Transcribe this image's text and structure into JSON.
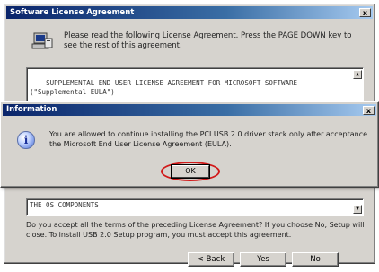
{
  "license_window": {
    "title": "Software License Agreement",
    "close_glyph": "x",
    "prompt": "Please read the following License Agreement. Press the PAGE DOWN key to see the rest of this agreement.",
    "license_text_top": "SUPPLEMENTAL END USER LICENSE AGREEMENT FOR MICROSOFT SOFTWARE (\"Supplemental EULA\")\n\nIMPORTANT: READ CAREFULLY - The Microsoft Corporation (\"Microsoft\") operating",
    "license_text_bottom": "THE OS COMPONENTS",
    "question": "Do you accept all the terms of the preceding License Agreement? If you choose No, Setup will close. To install USB 2.0 Setup program, you must accept this agreement.",
    "buttons": {
      "back": "< Back",
      "yes": "Yes",
      "no": "No"
    },
    "scroll_up_glyph": "▲",
    "scroll_down_glyph": "▼"
  },
  "info_dialog": {
    "title": "Information",
    "close_glyph": "x",
    "icon_glyph": "i",
    "message": "You are allowed to continue installing the PCI USB 2.0 driver stack only after acceptance the Microsoft End User License Agreement (EULA).",
    "ok_label": "OK",
    "highlight_color": "#d11a1a"
  }
}
